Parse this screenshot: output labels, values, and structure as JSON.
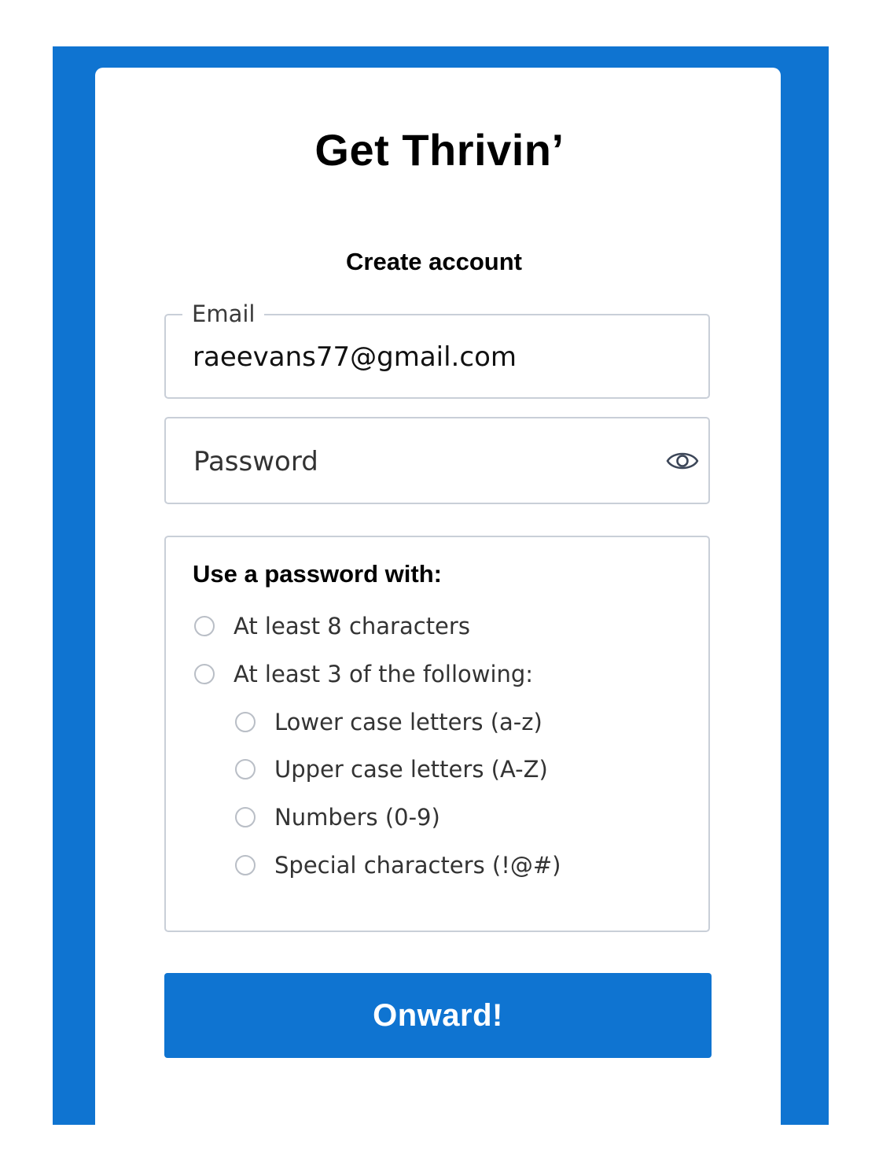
{
  "app": {
    "title": "Get Thrivin’",
    "subtitle": "Create account"
  },
  "form": {
    "email": {
      "label": "Email",
      "value": "raeevans77@gmail.com"
    },
    "password": {
      "placeholder": "Password",
      "toggle_icon": "eye-icon"
    }
  },
  "requirements": {
    "heading": "Use a password with:",
    "items": [
      {
        "label": "At least 8 characters",
        "level": 0,
        "checked": false
      },
      {
        "label": "At least 3 of the following:",
        "level": 0,
        "checked": false
      },
      {
        "label": "Lower case letters (a-z)",
        "level": 1,
        "checked": false
      },
      {
        "label": "Upper case letters (A-Z)",
        "level": 1,
        "checked": false
      },
      {
        "label": "Numbers (0-9)",
        "level": 1,
        "checked": false
      },
      {
        "label": "Special characters (!@#)",
        "level": 1,
        "checked": false
      }
    ]
  },
  "submit": {
    "label": "Onward!"
  },
  "colors": {
    "accent": "#0f74d1",
    "border": "#c9cfd8",
    "background": "#ffffff"
  }
}
